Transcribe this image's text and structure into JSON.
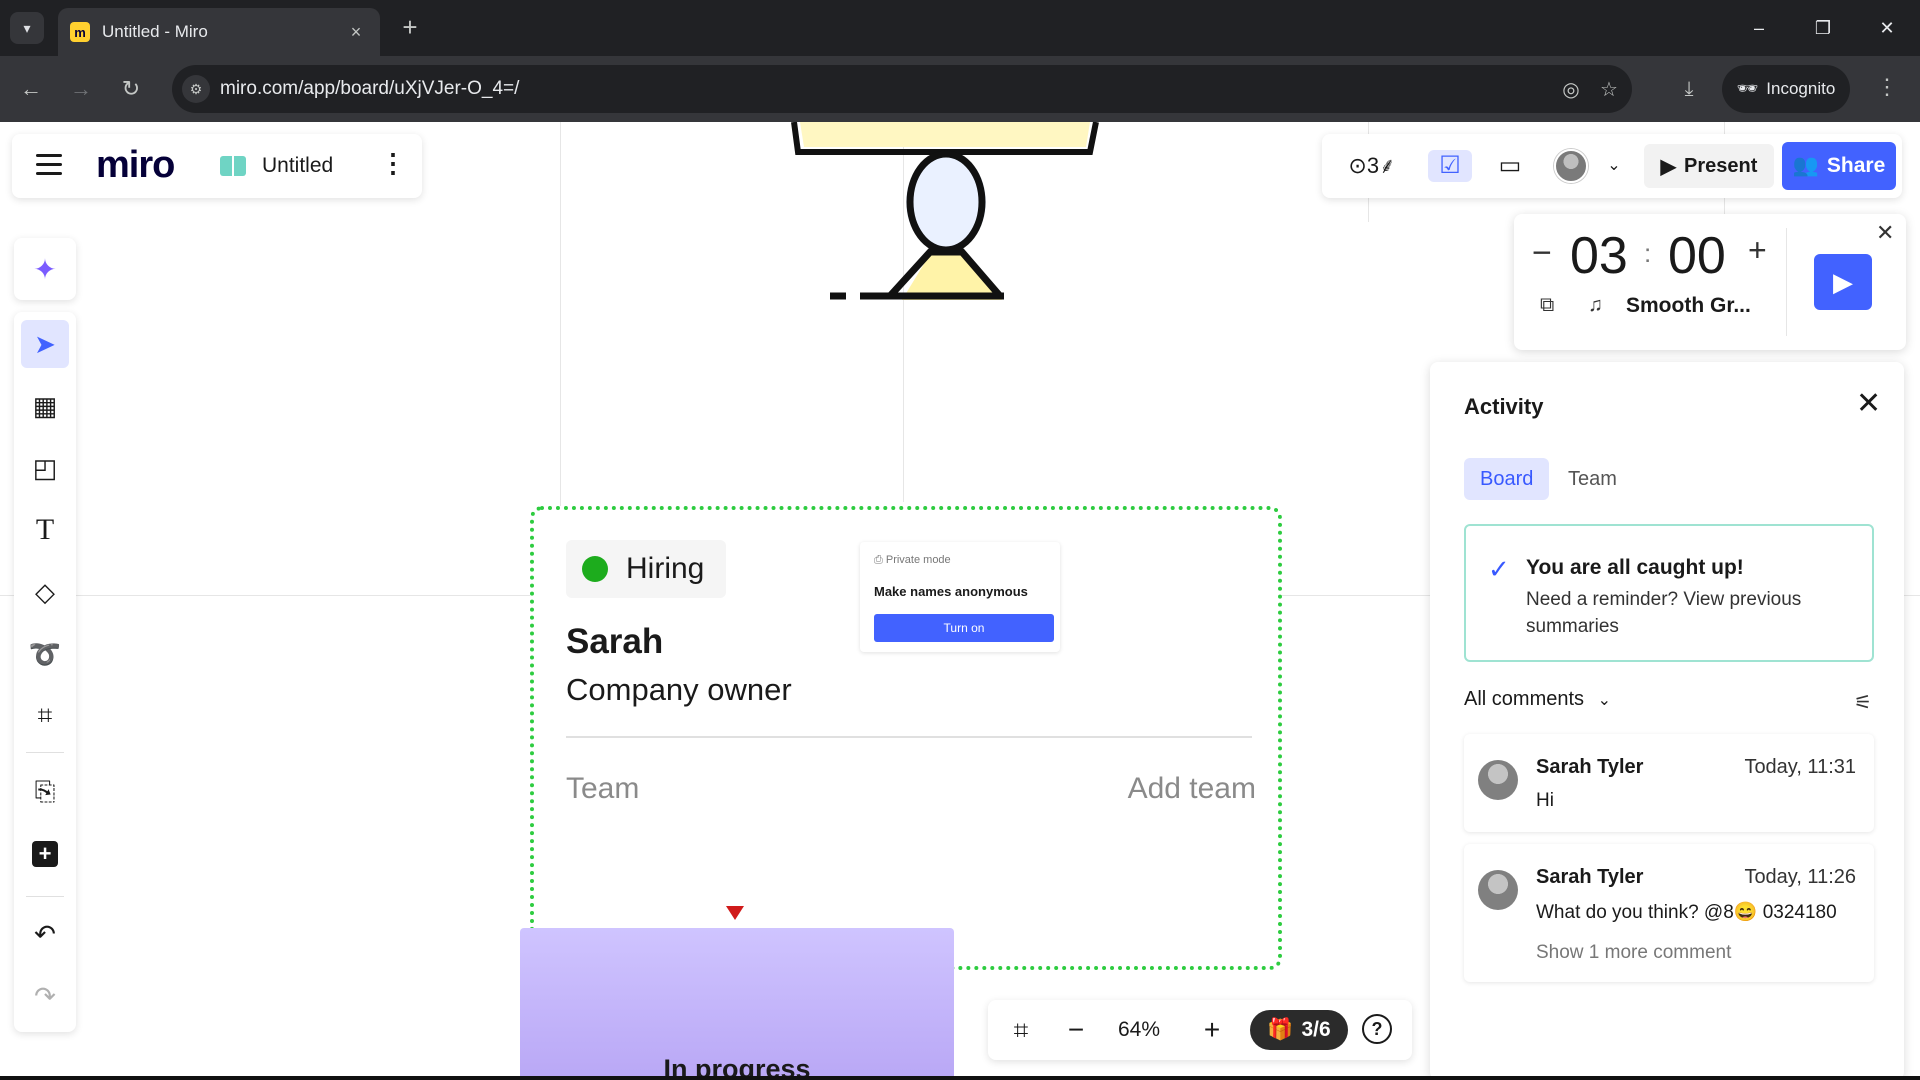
{
  "browser": {
    "tab_title": "Untitled - Miro",
    "tab_close": "×",
    "new_tab": "+",
    "url": "miro.com/app/board/uXjVJer-O_4=/",
    "incognito_label": "Incognito",
    "win_minimize": "–",
    "win_restore": "❐",
    "win_close": "✕"
  },
  "app": {
    "logo": "miro",
    "board_name": "Untitled",
    "present_label": "Present",
    "share_label": "Share",
    "reactions_label": "⊙3⸙"
  },
  "timer": {
    "minutes": "03",
    "seconds": "00",
    "separator": ":",
    "minus": "−",
    "plus": "+",
    "track": "Smooth Gr..."
  },
  "card": {
    "status": "Hiring",
    "name": "Sarah",
    "role": "Company owner",
    "team_label": "Team",
    "add_team_label": "Add team",
    "private_mode_label": "Private mode",
    "private_mode_title": "Make names anonymous",
    "private_mode_button": "Turn on"
  },
  "progress_card": {
    "label": "In progress"
  },
  "zoom_bar": {
    "zoom": "64%",
    "pages": "3/6",
    "help": "?",
    "minus": "−",
    "plus": "+"
  },
  "activity": {
    "title": "Activity",
    "tabs": [
      {
        "label": "Board",
        "active": true
      },
      {
        "label": "Team",
        "active": false
      }
    ],
    "caught_up_title": "You are all caught up!",
    "caught_up_text": "Need a reminder? View previous summaries",
    "filter_label": "All comments",
    "comments": [
      {
        "author": "Sarah Tyler",
        "time": "Today, 11:31",
        "text": "Hi"
      },
      {
        "author": "Sarah Tyler",
        "time": "Today, 11:26",
        "text": "What do you think? @8😄 0324180",
        "more": "Show 1 more comment"
      }
    ]
  },
  "colors": {
    "accent": "#4262ff",
    "status_green": "#1dac1d",
    "frame_border": "#2ecc40",
    "progress_purple": "#c3b5fa"
  }
}
